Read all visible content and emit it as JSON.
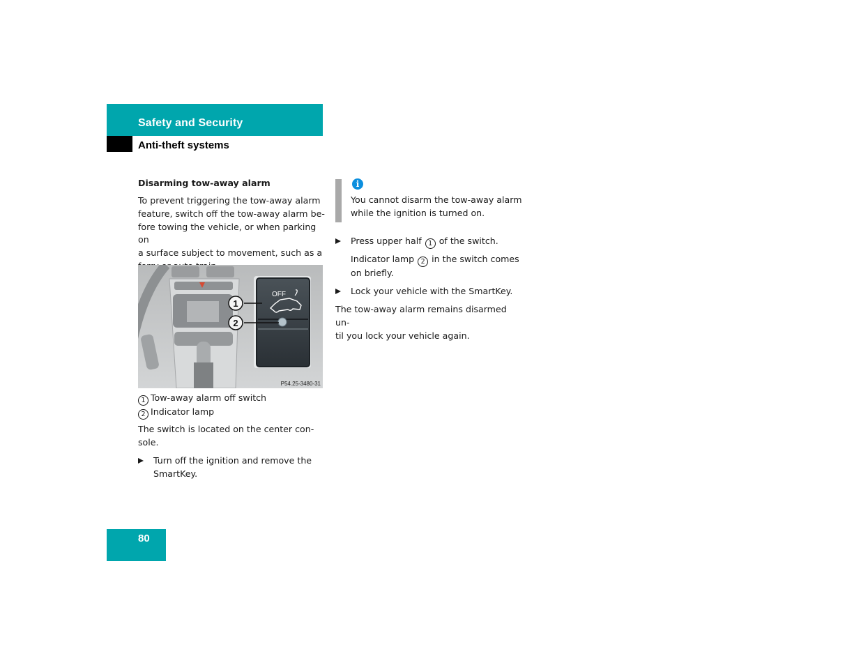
{
  "header": {
    "section_title": "Safety and Security",
    "subsection_title": "Anti-theft systems",
    "accent_color": "#00a6ad"
  },
  "left_column": {
    "heading": "Disarming tow-away alarm",
    "intro_lines": [
      "To prevent triggering the tow-away alarm",
      "feature, switch off the tow-away alarm be-",
      "fore towing the vehicle, or when parking on",
      "a surface subject to movement, such as a",
      "ferry or auto train."
    ],
    "figure": {
      "code": "P54.25-3480-31",
      "switch_label": "OFF",
      "callouts": [
        "1",
        "2"
      ]
    },
    "legend": [
      {
        "num": "1",
        "text": "Tow-away alarm off switch"
      },
      {
        "num": "2",
        "text": "Indicator lamp"
      }
    ],
    "location_lines": [
      "The switch is located on the center con-",
      "sole."
    ],
    "step1_lines": [
      "Turn off the ignition and remove the",
      "SmartKey."
    ]
  },
  "right_column": {
    "info_icon": "info-icon",
    "info_lines": [
      "You cannot disarm the tow-away alarm",
      "while the ignition is turned on."
    ],
    "step2": {
      "before": "Press upper half",
      "num": "1",
      "after": "of the switch."
    },
    "step2_note": {
      "before": "Indicator lamp",
      "num": "2",
      "after_line1": "in the switch comes",
      "line2": "on briefly."
    },
    "step3": "Lock your vehicle with the SmartKey.",
    "closing_lines": [
      "The tow-away alarm remains disarmed un-",
      "til you lock your vehicle again."
    ]
  },
  "footer": {
    "page_number": "80"
  }
}
